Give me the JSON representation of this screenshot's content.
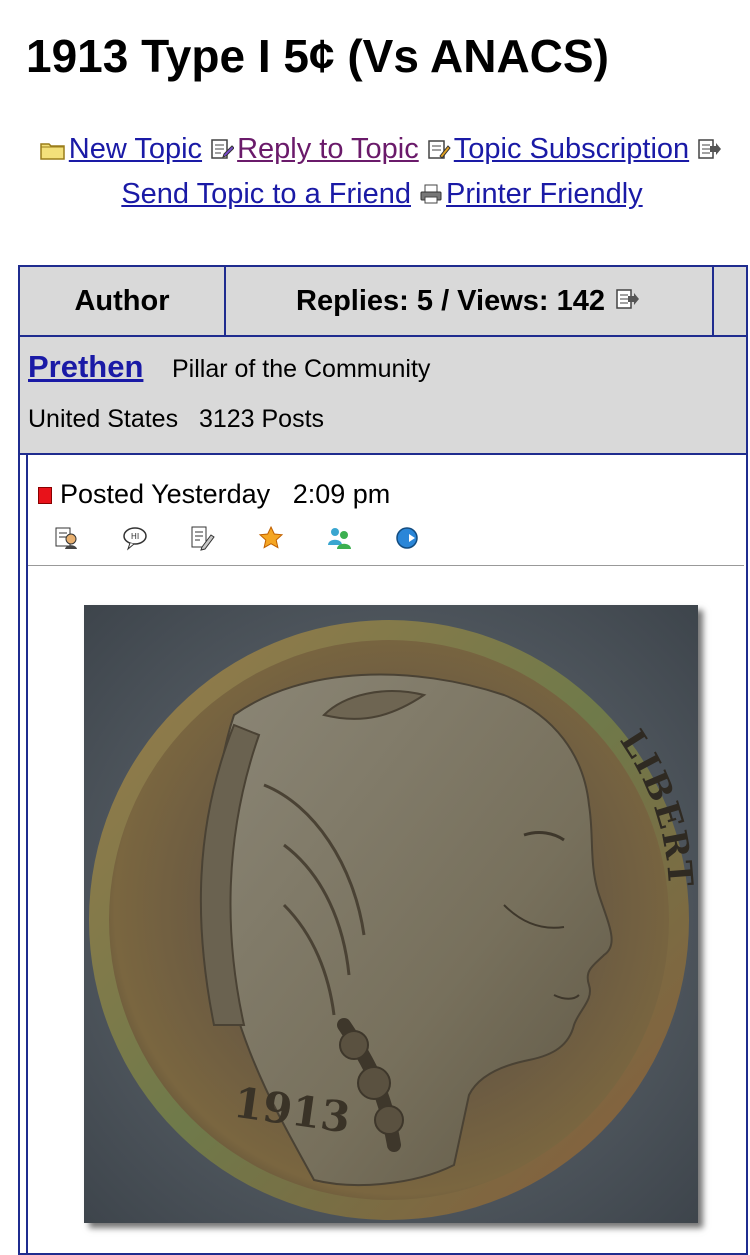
{
  "page": {
    "title": "1913 Type I 5¢ (Vs ANACS)"
  },
  "topic_actions": {
    "new_topic": "New Topic",
    "reply": "Reply to Topic",
    "subscription": "Topic Subscription",
    "send_to_friend": "Send Topic to a Friend",
    "printer_friendly": "Printer Friendly"
  },
  "table": {
    "author_header": "Author",
    "stats_header": "Replies: 5 / Views: 142"
  },
  "post": {
    "author": "Prethen",
    "rank": "Pillar of the Community",
    "country": "United States",
    "posts": "3123 Posts",
    "posted_label": "Posted",
    "posted_day": "Yesterday",
    "posted_time": "2:09 pm",
    "tool_icons": [
      "profile-icon",
      "message-icon",
      "edit-icon",
      "star-icon",
      "buddy-icon",
      "web-icon"
    ]
  },
  "coin": {
    "legend": "LIBERTY",
    "date": "1913",
    "colors": {
      "field": "#5c646b",
      "coin": "#6e5a3e",
      "rim": "#8a6d46"
    }
  }
}
